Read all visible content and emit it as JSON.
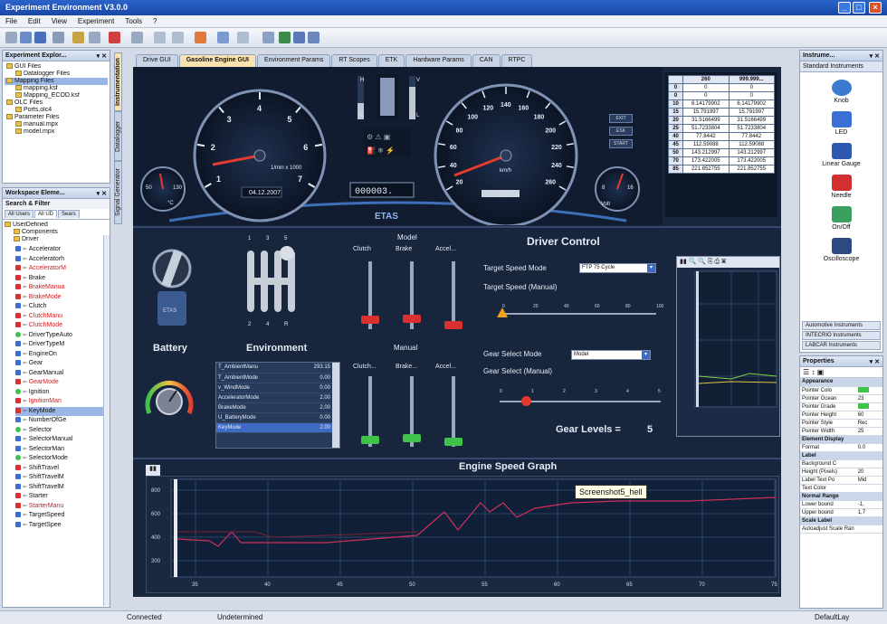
{
  "window": {
    "title": "Experiment Environment V3.0.0"
  },
  "menu": [
    "File",
    "Edit",
    "View",
    "Experiment",
    "Tools",
    "?"
  ],
  "explorer": {
    "title": "Experiment Explor...",
    "items": [
      {
        "label": "GUI Files",
        "level": 0
      },
      {
        "label": "Datalogger Files",
        "level": 1
      },
      {
        "label": "Mapping Files",
        "level": 0,
        "selected": true
      },
      {
        "label": "mapping.ksf",
        "level": 1
      },
      {
        "label": "Mapping_ECOD.ksf",
        "level": 1
      },
      {
        "label": "OLC Files",
        "level": 0
      },
      {
        "label": "Ports.olc4",
        "level": 1
      },
      {
        "label": "Parameter Files",
        "level": 0
      },
      {
        "label": "manual.mpx",
        "level": 1
      },
      {
        "label": "model.mpx",
        "level": 1
      }
    ]
  },
  "workspace": {
    "title": "Workspace Eleme...",
    "search": "Search & Filter",
    "tabs": [
      "All Users",
      "All UD",
      "Sears"
    ],
    "root": "UserDefined",
    "groups": [
      "Components",
      "Driver"
    ],
    "items": [
      {
        "label": "Accelerator",
        "color": "#3a6fd6"
      },
      {
        "label": "Acceleratorh",
        "color": "#3a6fd6"
      },
      {
        "label": "AcceleratorM",
        "color": "#d93030",
        "red": true
      },
      {
        "label": "Brake",
        "color": "#d93030"
      },
      {
        "label": "BrakeManua",
        "color": "#d93030",
        "red": true
      },
      {
        "label": "BrakeMode",
        "color": "#d93030",
        "red": true
      },
      {
        "label": "Clutch",
        "color": "#3a6fd6"
      },
      {
        "label": "ClutchManu",
        "color": "#d93030",
        "red": true
      },
      {
        "label": "ClutchMode",
        "color": "#d93030",
        "red": true
      },
      {
        "label": "DriverTypeAuto",
        "color": "#3ec24a"
      },
      {
        "label": "DriverTypeM",
        "color": "#3a6fd6"
      },
      {
        "label": "EngineOn",
        "color": "#3a6fd6"
      },
      {
        "label": "Gear",
        "color": "#3a6fd6"
      },
      {
        "label": "GearManual",
        "color": "#3a6fd6"
      },
      {
        "label": "GearMode",
        "color": "#d93030",
        "red": true
      },
      {
        "label": "Ignition",
        "color": "#3ec24a"
      },
      {
        "label": "IgnitionMan",
        "color": "#d93030",
        "red": true
      },
      {
        "label": "KeyMode",
        "color": "#d93030",
        "sel": true
      },
      {
        "label": "NumberOfGe",
        "color": "#3a6fd6"
      },
      {
        "label": "Selector",
        "color": "#3ec24a"
      },
      {
        "label": "SelectorManual",
        "color": "#3a6fd6"
      },
      {
        "label": "SelectorMan",
        "color": "#3a6fd6"
      },
      {
        "label": "SelectorMode",
        "color": "#3ec24a"
      },
      {
        "label": "ShiftTravel",
        "color": "#d93030"
      },
      {
        "label": "ShiftTravelM",
        "color": "#3a6fd6"
      },
      {
        "label": "ShiftTravelM",
        "color": "#3a6fd6"
      },
      {
        "label": "Starter",
        "color": "#d93030"
      },
      {
        "label": "StarterManu",
        "color": "#d93030",
        "red": true
      },
      {
        "label": "TargetSpeed",
        "color": "#3a6fd6"
      },
      {
        "label": "TargetSpee",
        "color": "#3a6fd6"
      }
    ]
  },
  "side_tabs": [
    "Instrumentation",
    "Datalogger",
    "Signal Generator"
  ],
  "tabs": [
    "Drive GUI",
    "Gasoline Engine GUI",
    "Environment Params",
    "RT Scopes",
    "ETK",
    "Hardware Params",
    "CAN",
    "RTPC"
  ],
  "active_tab": "Gasoline Engine GUI",
  "dashboard": {
    "rpm_ticks": [
      "1",
      "2",
      "3",
      "4",
      "5",
      "6",
      "7"
    ],
    "rpm_unit": "1/min x 1000",
    "date": "04.12.2007",
    "speed_ticks": [
      "20",
      "40",
      "60",
      "80",
      "100",
      "120",
      "140",
      "160",
      "180",
      "200",
      "220",
      "240",
      "260"
    ],
    "speed_unit": "km/h",
    "odometer": "000003.",
    "brand": "ETAS",
    "small_left": {
      "min": "50",
      "max": "130",
      "unit": "°C"
    },
    "small_right": {
      "min": "8",
      "max": "16",
      "unit": "Volt"
    },
    "bars": [
      "H",
      "C",
      "V",
      "L"
    ],
    "buttons": [
      "EXIT",
      "ESK",
      "START"
    ]
  },
  "table": {
    "headers": [
      "",
      "260",
      "999.999..."
    ],
    "rows": [
      [
        "0",
        "0",
        "0"
      ],
      [
        "0",
        "0",
        "0"
      ],
      [
        "10",
        "6.14179902",
        "6.14179902"
      ],
      [
        "15",
        "15.791997",
        "15.791997"
      ],
      [
        "20",
        "31.5166499",
        "31.5166499"
      ],
      [
        "25",
        "51.7233804",
        "51.7233804"
      ],
      [
        "40",
        "77.8442",
        "77.8442"
      ],
      [
        "45",
        "112.59088",
        "112.59088"
      ],
      [
        "50",
        "143.212997",
        "143.212997"
      ],
      [
        "70",
        "173.422005",
        "173.422005"
      ],
      [
        "85",
        "221.852755",
        "221.852755"
      ]
    ]
  },
  "labels": {
    "battery": "Battery",
    "environment": "Environment",
    "model": "Model",
    "manual": "Manual",
    "driver_control": "Driver Control",
    "target_speed_mode": "Target Speed Mode",
    "target_speed_manual": "Target Speed (Manual)",
    "gear_select_mode": "Gear Select Mode",
    "gear_select_manual": "Gear Select (Manual)",
    "gear_levels": "Gear Levels  =",
    "gear_levels_value": "5",
    "clutch": "Clutch",
    "brake": "Brake",
    "accel": "Accel...",
    "clutch_m": "Clutch...",
    "brake_m": "Brake...",
    "accel_m": "Accel...",
    "shifter_top": [
      "1",
      "3",
      "5"
    ],
    "shifter_bot": [
      "2",
      "4",
      "R"
    ],
    "engine_graph": "Engine Speed Graph",
    "tooltip": "Screenshot5_hell"
  },
  "dropdowns": {
    "target_speed_mode": "FTP 75 Cycle",
    "gear_select_mode": "Model"
  },
  "speed_slider_ticks": [
    "0",
    "20",
    "40",
    "60",
    "80",
    "100"
  ],
  "gear_slider_ticks": [
    "0",
    "1",
    "2",
    "3",
    "4",
    "5"
  ],
  "environment_table": [
    {
      "name": "T_AmbientManu",
      "value": "293.15"
    },
    {
      "name": "T_AmbientMode",
      "value": "0.00"
    },
    {
      "name": "v_WindMode",
      "value": "0.00"
    },
    {
      "name": "AcceleratorMode",
      "value": "2.00"
    },
    {
      "name": "BrakeMode",
      "value": "2.00"
    },
    {
      "name": "U_BatteryMode",
      "value": "0.00"
    },
    {
      "name": "KeyMode",
      "value": "2.00"
    }
  ],
  "graph": {
    "x_ticks": [
      "35",
      "40",
      "45",
      "50",
      "55",
      "60",
      "65",
      "70",
      "75"
    ],
    "y_ticks": [
      "800",
      "600",
      "400",
      "200"
    ]
  },
  "instruments": {
    "title": "Instrume...",
    "header": "Standard Instruments",
    "items": [
      {
        "label": "Knob",
        "icon": "knob-icon"
      },
      {
        "label": "LED",
        "icon": "led-icon"
      },
      {
        "label": "Linear Gauge",
        "icon": "linear-gauge-icon"
      },
      {
        "label": "Needle",
        "icon": "needle-icon"
      },
      {
        "label": "On/Off",
        "icon": "on-off-icon"
      },
      {
        "label": "Oscilloscope",
        "icon": "oscilloscope-icon"
      }
    ],
    "categories": [
      "Automotive Instruments",
      "INTECRIO Instruments",
      "LABCAR Instruments"
    ]
  },
  "properties": {
    "title": "Properties",
    "rows": [
      {
        "cat": "Appearance"
      },
      {
        "k": "Pointer Colo",
        "v": ""
      },
      {
        "k": "Pointer Ocean",
        "v": "23"
      },
      {
        "k": "Pointer Grade",
        "v": ""
      },
      {
        "k": "Pointer Height",
        "v": "60"
      },
      {
        "k": "Pointer Style",
        "v": "Rec"
      },
      {
        "k": "Pointer Width",
        "v": "25"
      },
      {
        "cat": "Element Display"
      },
      {
        "k": "Format",
        "v": "0.0"
      },
      {
        "cat": "Label"
      },
      {
        "k": "Background C",
        "v": ""
      },
      {
        "k": "Height (Pixels)",
        "v": "20"
      },
      {
        "k": "Label Text Po",
        "v": "Mid"
      },
      {
        "k": "Text Color",
        "v": ""
      },
      {
        "cat": "Normal Range"
      },
      {
        "k": "Lower bound",
        "v": "-1,"
      },
      {
        "k": "Upper bound",
        "v": "1,7"
      },
      {
        "cat": "Scale Label"
      },
      {
        "k": "Autoadjust Scale Ran",
        "v": ""
      }
    ]
  },
  "status": {
    "left": "Connected",
    "mid": "Undetermined",
    "right": "DefaultLay"
  }
}
